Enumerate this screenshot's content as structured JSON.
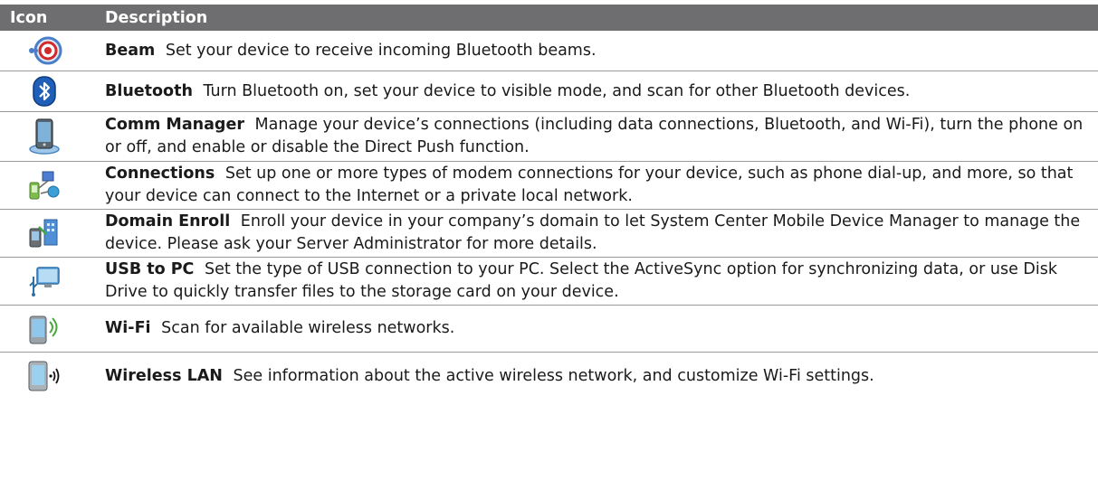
{
  "header": {
    "icon": "Icon",
    "description": "Description"
  },
  "rows": [
    {
      "icon": "beam-icon",
      "name": "Beam",
      "text": "Set your device to receive incoming Bluetooth beams."
    },
    {
      "icon": "bluetooth-icon",
      "name": "Bluetooth",
      "text": "Turn Bluetooth on, set your device to visible mode, and scan for other Bluetooth devices."
    },
    {
      "icon": "comm-manager-icon",
      "name": "Comm Manager",
      "text": "Manage your device’s connections (including data connections, Bluetooth, and Wi-Fi), turn the phone on or off, and enable or disable the Direct Push function."
    },
    {
      "icon": "connections-icon",
      "name": "Connections",
      "text": "Set up one or more types of modem connections for your device, such as phone dial-up, and more, so that your device can connect to the Internet or a private local network."
    },
    {
      "icon": "domain-enroll-icon",
      "name": "Domain Enroll",
      "text": "Enroll your device in your company’s domain to let System Center Mobile Device Manager to manage the device. Please ask your Server Administrator for more details."
    },
    {
      "icon": "usb-to-pc-icon",
      "name": "USB to PC",
      "text": "Set the type of USB connection to your PC. Select the ActiveSync option for synchronizing data, or use Disk Drive to quickly transfer files to the storage card on your device."
    },
    {
      "icon": "wifi-icon",
      "name": "Wi-Fi",
      "text": "Scan for available wireless networks."
    },
    {
      "icon": "wireless-lan-icon",
      "name": "Wireless LAN",
      "text": "See information about the active wireless network, and customize Wi-Fi settings."
    }
  ]
}
